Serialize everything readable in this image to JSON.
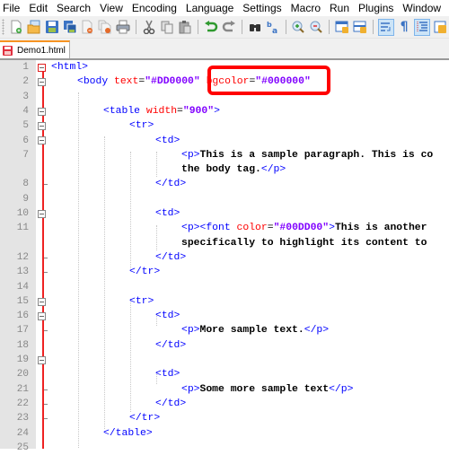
{
  "menubar": {
    "items": [
      "File",
      "Edit",
      "Search",
      "View",
      "Encoding",
      "Language",
      "Settings",
      "Macro",
      "Run",
      "Plugins",
      "Window",
      "?"
    ]
  },
  "toolbar": {
    "buttons": [
      {
        "icon": "new-file-icon"
      },
      {
        "icon": "open-file-icon"
      },
      {
        "icon": "save-icon"
      },
      {
        "icon": "save-all-icon"
      },
      {
        "icon": "close-icon"
      },
      {
        "icon": "close-all-icon"
      },
      {
        "icon": "print-icon"
      },
      {
        "icon": "cut-icon"
      },
      {
        "icon": "copy-icon"
      },
      {
        "icon": "paste-icon"
      },
      {
        "icon": "undo-icon"
      },
      {
        "icon": "redo-icon"
      },
      {
        "icon": "find-icon"
      },
      {
        "icon": "replace-icon"
      },
      {
        "icon": "zoom-in-icon"
      },
      {
        "icon": "zoom-out-icon"
      },
      {
        "icon": "sync-vertical-icon"
      },
      {
        "icon": "sync-horizontal-icon"
      },
      {
        "icon": "word-wrap-icon",
        "active": true
      },
      {
        "icon": "show-all-chars-icon"
      },
      {
        "icon": "indent-guide-icon",
        "active": true
      },
      {
        "icon": "user-defined-lang-icon"
      }
    ]
  },
  "tabs": [
    {
      "label": "Demo1.html",
      "active": true
    }
  ],
  "editor": {
    "line_numbers": [
      "1",
      "2",
      "3",
      "4",
      "5",
      "6",
      "7",
      "",
      "8",
      "9",
      "10",
      "11",
      "",
      "12",
      "13",
      "14",
      "15",
      "16",
      "17",
      "18",
      "19",
      "20",
      "21",
      "22",
      "23",
      "24",
      "25"
    ],
    "lines": {
      "l1_tag": "<html>",
      "l2_open": "<body ",
      "l2_attr1": "text",
      "l2_eq1": "=",
      "l2_val1": "\"#DD0000\"",
      "l2_attr2": "bgcolor",
      "l2_eq2": "=",
      "l2_val2": "\"#000000\"",
      "l4_open": "<table ",
      "l4_attr": "width",
      "l4_eq": "=",
      "l4_val": "\"900\"",
      "l4_close": ">",
      "l5_tag": "<tr>",
      "l6_tag": "<td>",
      "l7_open": "<p>",
      "l7_text": "This is a sample paragraph. This is co",
      "l7b_text": "the body tag.",
      "l7b_close": "</p>",
      "l8_tag": "</td>",
      "l10_tag": "<td>",
      "l11_open": "<p><font ",
      "l11_attr": "color",
      "l11_eq": "=",
      "l11_val": "\"#00DD00\"",
      "l11_close": ">",
      "l11_text": "This is another",
      "l11b_text": "specifically to highlight its content to",
      "l12_tag": "</td>",
      "l13_tag": "</tr>",
      "l15_tag": "<tr>",
      "l16_tag": "<td>",
      "l17_open": "<p>",
      "l17_text": "More sample text.",
      "l17_close": "</p>",
      "l18_tag": "</td>",
      "l20_tag": "<td>",
      "l21_open": "<p>",
      "l21_text": "Some more sample text",
      "l21_close": "</p>",
      "l22_tag": "</td>",
      "l23_tag": "</tr>",
      "l24_tag": "</table>"
    }
  },
  "annotation": {
    "highlight_color": "#ff0000",
    "highlighted_text": "bgcolor=\"#000000\""
  }
}
